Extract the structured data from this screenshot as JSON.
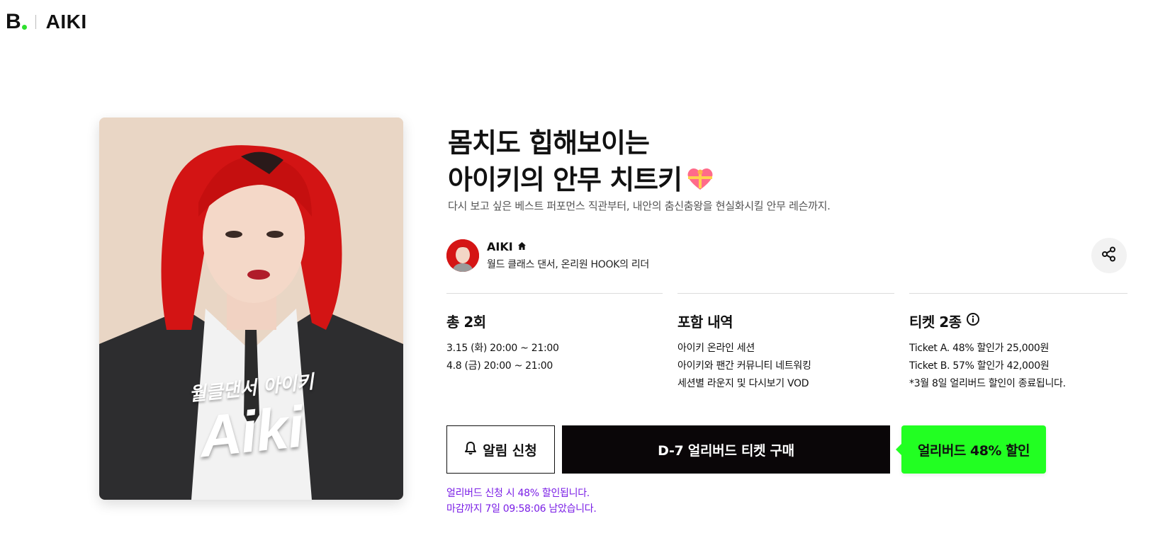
{
  "header": {
    "logo_letter": "B",
    "brand": "AIKI"
  },
  "hero": {
    "caption": "월클댄서 아이키",
    "name": "Aiki"
  },
  "product": {
    "title_line1": "몸치도 힙해보이는",
    "title_line2": "아이키의 안무 치트키",
    "subtitle": "다시 보고 싶은 베스트 퍼포먼스 직관부터, 내안의 춤신춤왕을 현실화시킬 안무 레슨까지."
  },
  "creator": {
    "name": "AIKI",
    "description": "월드 클래스 댄서, 온리원 HOOK의 리더"
  },
  "info": {
    "sessions": {
      "title": "총 2회",
      "lines": [
        "3.15 (화) 20:00 ~ 21:00",
        "4.8 (금) 20:00 ~ 21:00"
      ]
    },
    "includes": {
      "title": "포함 내역",
      "lines": [
        "아이키 온라인 세션",
        "아이키와 팬간 커뮤니티 네트워킹",
        "세션별 라운지 및 다시보기 VOD"
      ]
    },
    "tickets": {
      "title": "티켓 2종",
      "lines": [
        "Ticket A. 48% 할인가 25,000원",
        "Ticket B. 57% 할인가 42,000원",
        "*3월 8일 얼리버드 할인이 종료됩니다."
      ]
    }
  },
  "actions": {
    "notify_label": "알림 신청",
    "buy_label": "D-7 얼리버드 티켓 구매",
    "discount_badge": "얼리버드 48% 할인"
  },
  "notice": {
    "line1": "얼리버드 신청 시 48% 할인됩니다.",
    "line2": "마감까지 7일 09:58:06 남았습니다."
  },
  "colors": {
    "accent_green": "#22ff22",
    "buy_button": "#0a0608",
    "notice_purple": "#7a1ee6"
  },
  "icons": [
    "bell-icon",
    "share-icon",
    "home-icon",
    "info-icon",
    "gift-heart-icon"
  ]
}
